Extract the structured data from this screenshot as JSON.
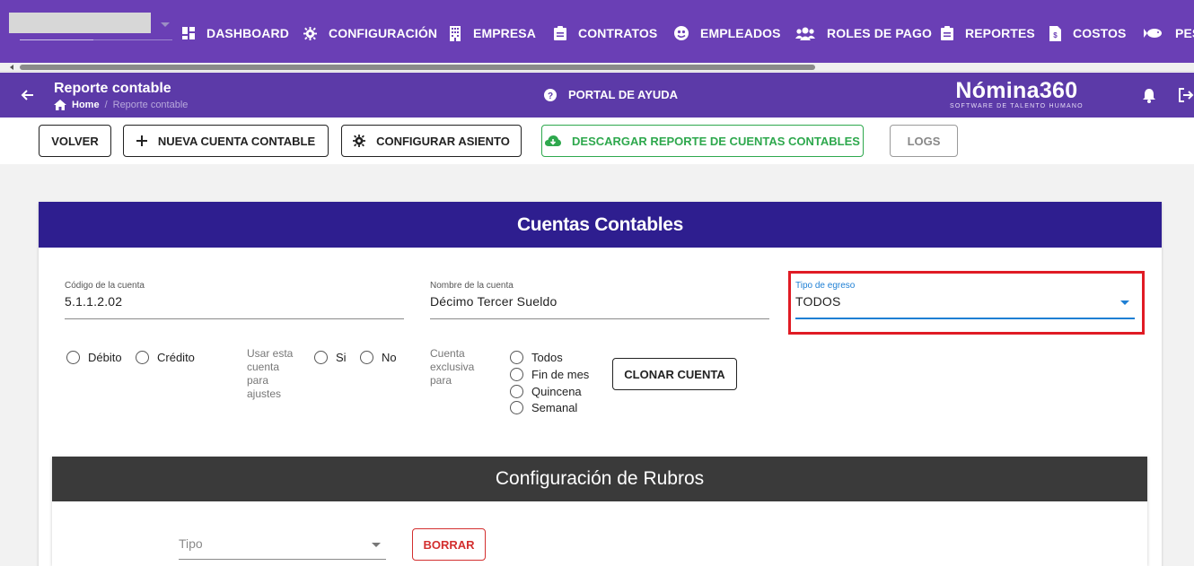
{
  "topnav": {
    "items": [
      {
        "label": "DASHBOARD",
        "icon": "dashboard-icon"
      },
      {
        "label": "CONFIGURACIÓN",
        "icon": "gear-icon"
      },
      {
        "label": "EMPRESA",
        "icon": "building-icon"
      },
      {
        "label": "CONTRATOS",
        "icon": "clipboard-icon"
      },
      {
        "label": "EMPLEADOS",
        "icon": "employees-icon"
      },
      {
        "label": "ROLES DE PAGO",
        "icon": "users-icon"
      },
      {
        "label": "REPORTES",
        "icon": "clipboard-icon"
      },
      {
        "label": "COSTOS",
        "icon": "invoice-icon"
      },
      {
        "label": "PES",
        "icon": "fish-icon"
      }
    ]
  },
  "subbar": {
    "title": "Reporte contable",
    "breadcrumb": {
      "home": "Home",
      "current": "Reporte contable"
    },
    "help": "PORTAL DE AYUDA",
    "brand": "Nómina360",
    "brand_tagline": "SOFTWARE DE TALENTO HUMANO"
  },
  "toolbar": {
    "volver": "VOLVER",
    "nueva_cuenta": "NUEVA CUENTA CONTABLE",
    "configurar_asiento": "CONFIGURAR ASIENTO",
    "descargar": "DESCARGAR REPORTE DE CUENTAS CONTABLES",
    "logs": "LOGS"
  },
  "card": {
    "title": "Cuentas Contables",
    "codigo": {
      "label": "Código de la cuenta",
      "value": "5.1.1.2.02"
    },
    "nombre": {
      "label": "Nombre de la cuenta",
      "value": "Décimo Tercer Sueldo"
    },
    "tipo_egreso": {
      "label": "Tipo de egreso",
      "value": "TODOS"
    },
    "debito": "Débito",
    "credito": "Crédito",
    "usar_ajustes_label": "Usar esta cuenta para ajustes",
    "si": "Si",
    "no": "No",
    "exclusiva_label": "Cuenta exclusiva para",
    "exclusiva_options": [
      "Todos",
      "Fin de mes",
      "Quincena",
      "Semanal"
    ],
    "clonar": "CLONAR CUENTA"
  },
  "rubros": {
    "title": "Configuración de Rubros",
    "tipo_placeholder": "Tipo",
    "borrar": "BORRAR"
  },
  "colors": {
    "topnav": "#6a3fb5",
    "subbar": "#5c3aa8",
    "card_header": "#2e1e8f",
    "rubros_header": "#3a3a3a",
    "accent_blue": "#1e7fd4",
    "green": "#2ea84d",
    "highlight_red": "#e01b24"
  }
}
